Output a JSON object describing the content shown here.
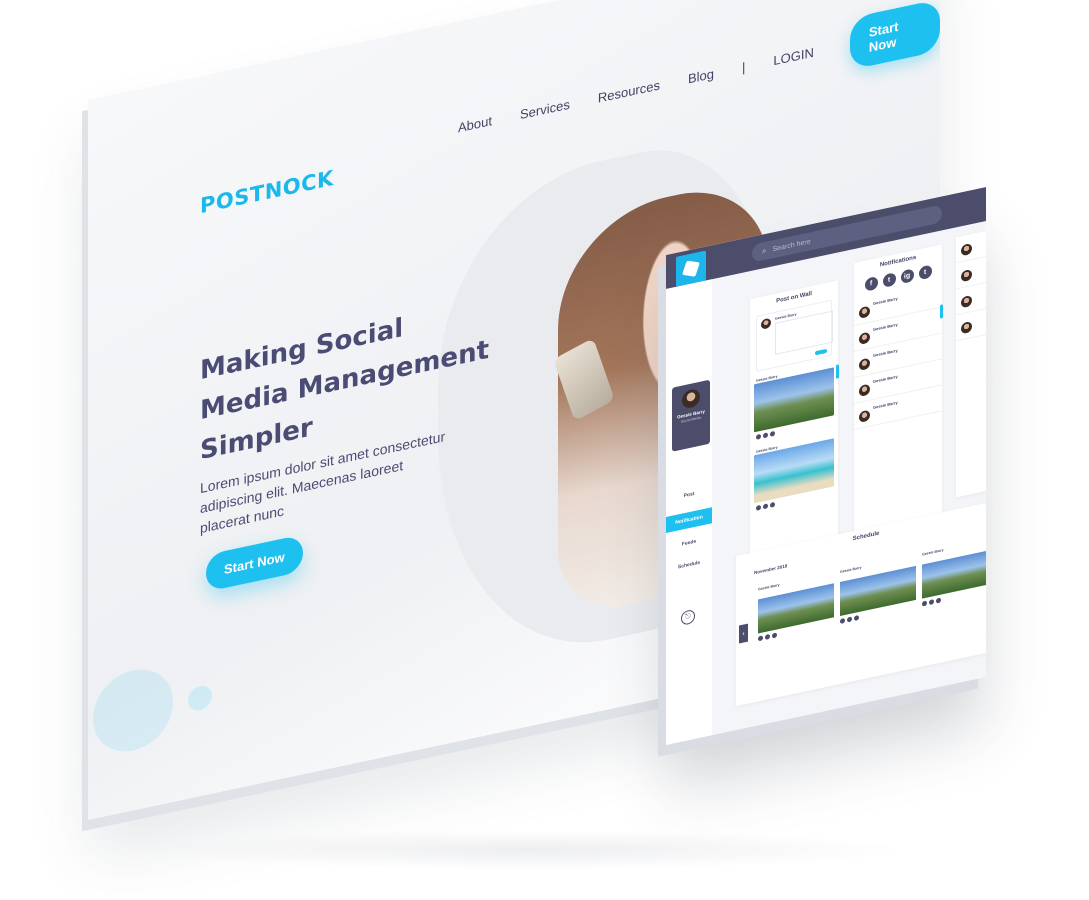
{
  "landing": {
    "brand": "POSTNOCK",
    "nav": [
      {
        "label": "About"
      },
      {
        "label": "Services"
      },
      {
        "label": "Resources"
      },
      {
        "label": "Blog"
      }
    ],
    "separator": "|",
    "login": "LOGIN",
    "nav_cta": "Start Now",
    "headline": "Making Social Media Management Simpler",
    "subtext": "Lorem ipsum dolor sit amet consectetur adipiscing elit. Maecenas laoreet placerat nunc",
    "cta": "Start Now"
  },
  "dashboard": {
    "search_placeholder": "Search here",
    "profile": {
      "name": "Gessie Barry",
      "role": "Social Media"
    },
    "sidebar_items": [
      "Post",
      "Notification",
      "Feeds",
      "Schedule"
    ],
    "active_item": "Notification",
    "wall_title": "Post on Wall",
    "notifications_title": "Notifications",
    "social_icons": [
      "f",
      "t",
      "ig",
      "t"
    ],
    "author": "Gessie Barry",
    "schedule_title": "Schedule",
    "schedule_date": "November 2018"
  },
  "colors": {
    "accent": "#1ec0ef",
    "dark": "#4b4d6b",
    "text": "#4a4c74"
  }
}
